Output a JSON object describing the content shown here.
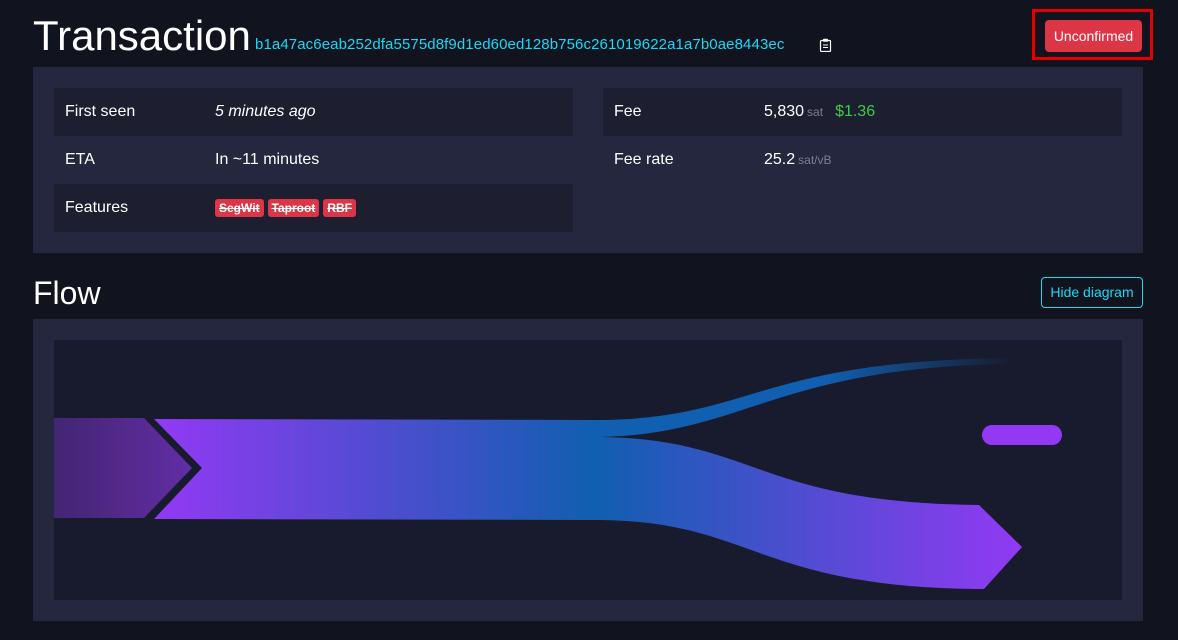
{
  "header": {
    "title": "Transaction",
    "txid": "b1a47ac6eab252dfa5575d8f9d1ed60ed128b756c261019622a1a7b0ae8443ec",
    "status": "Unconfirmed"
  },
  "details": {
    "left": [
      {
        "label": "First seen",
        "value": "5 minutes ago"
      },
      {
        "label": "ETA",
        "value": "In ~11 minutes"
      },
      {
        "label": "Features",
        "badges": [
          "SegWit",
          "Taproot",
          "RBF"
        ]
      }
    ],
    "right": [
      {
        "label": "Fee",
        "value": "5,830",
        "unit": "sat",
        "usd": "$1.36"
      },
      {
        "label": "Fee rate",
        "value": "25.2",
        "unit": "sat/vB"
      }
    ]
  },
  "flow": {
    "title": "Flow",
    "hide_label": "Hide diagram"
  },
  "colors": {
    "accent": "#1bd8f4",
    "danger": "#dc3545",
    "usd": "#3bcc49",
    "flow_purple": "#9339f4",
    "flow_blue": "#105fb0"
  }
}
